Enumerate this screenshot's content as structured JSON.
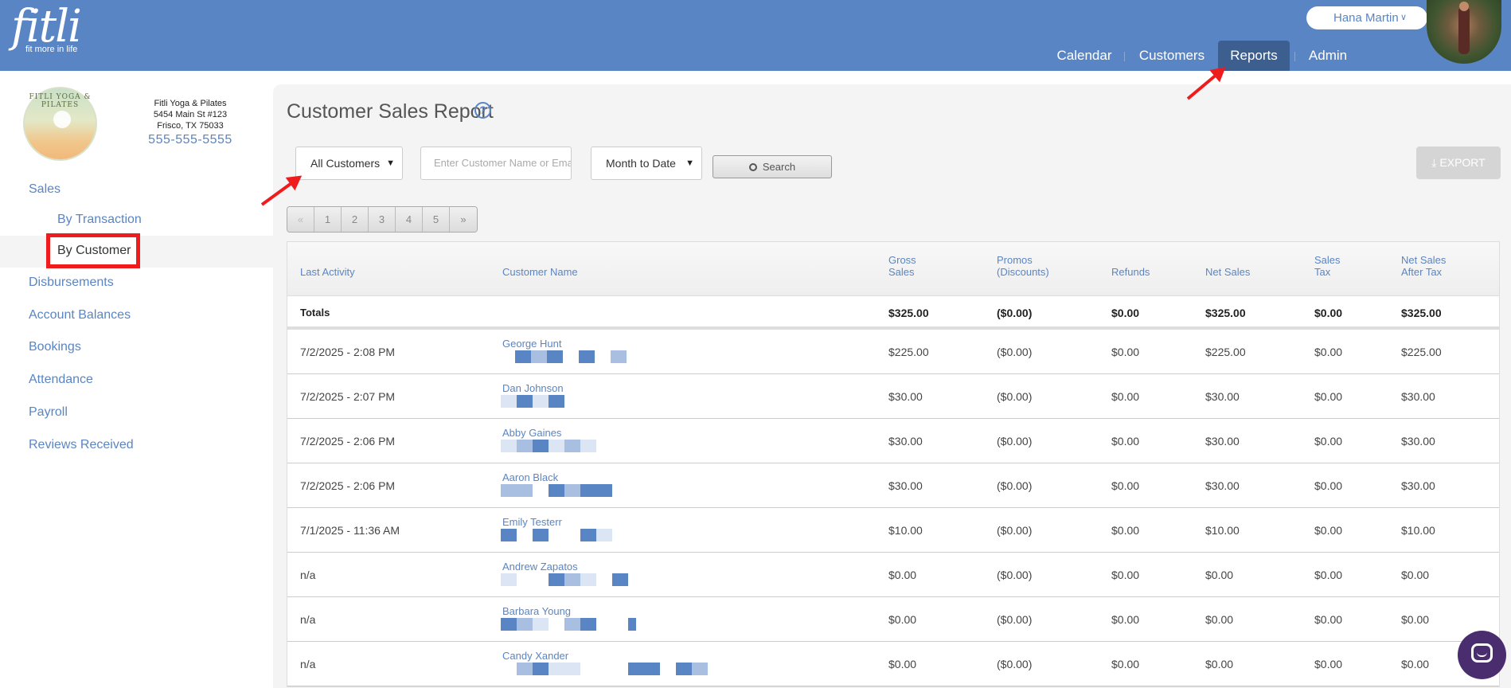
{
  "header": {
    "logo_text": "fitli",
    "logo_tagline": "fit more in life",
    "user_name": "Hana Martin",
    "nav": [
      {
        "label": "Calendar"
      },
      {
        "label": "Customers"
      },
      {
        "label": "Reports"
      },
      {
        "label": "Admin"
      }
    ]
  },
  "studio": {
    "logo_ring_text": "FITLI YOGA & PILATES",
    "name": "Fitli Yoga & Pilates",
    "address1": "5454 Main St #123",
    "address2": "Frisco, TX 75033",
    "phone": "555-555-5555"
  },
  "sidebar": {
    "sales": "Sales",
    "by_transaction": "By Transaction",
    "by_customer": "By Customer",
    "disbursements": "Disbursements",
    "account_balances": "Account Balances",
    "bookings": "Bookings",
    "attendance": "Attendance",
    "payroll": "Payroll",
    "reviews_received": "Reviews Received"
  },
  "report": {
    "title": "Customer Sales Report",
    "help_glyph": "?",
    "customer_filter": "All Customers",
    "search_placeholder": "Enter Customer Name or Email",
    "date_range": "Month to Date",
    "search_label": "Search",
    "export_label": "EXPORT",
    "pages": [
      "«",
      "1",
      "2",
      "3",
      "4",
      "5",
      "»"
    ]
  },
  "table": {
    "columns": {
      "last_activity": "Last Activity",
      "customer_name": "Customer Name",
      "gross_sales_1": "Gross",
      "gross_sales_2": "Sales",
      "promos_1": "Promos",
      "promos_2": "(Discounts)",
      "refunds": "Refunds",
      "net_sales": "Net Sales",
      "sales_tax_1": "Sales",
      "sales_tax_2": "Tax",
      "net_after_tax_1": "Net Sales",
      "net_after_tax_2": "After Tax"
    },
    "totals": {
      "label": "Totals",
      "gross": "$325.00",
      "promos": "($0.00)",
      "refunds": "$0.00",
      "net": "$325.00",
      "tax": "$0.00",
      "net_after_tax": "$325.00"
    },
    "rows": [
      {
        "last_activity": "7/2/2025 - 2:08 PM",
        "name": "George Hunt",
        "gross": "$225.00",
        "promos": "($0.00)",
        "refunds": "$0.00",
        "net": "$225.00",
        "tax": "$0.00",
        "net_after_tax": "$225.00"
      },
      {
        "last_activity": "7/2/2025 - 2:07 PM",
        "name": "Dan Johnson",
        "gross": "$30.00",
        "promos": "($0.00)",
        "refunds": "$0.00",
        "net": "$30.00",
        "tax": "$0.00",
        "net_after_tax": "$30.00"
      },
      {
        "last_activity": "7/2/2025 - 2:06 PM",
        "name": "Abby Gaines",
        "gross": "$30.00",
        "promos": "($0.00)",
        "refunds": "$0.00",
        "net": "$30.00",
        "tax": "$0.00",
        "net_after_tax": "$30.00"
      },
      {
        "last_activity": "7/2/2025 - 2:06 PM",
        "name": "Aaron Black",
        "gross": "$30.00",
        "promos": "($0.00)",
        "refunds": "$0.00",
        "net": "$30.00",
        "tax": "$0.00",
        "net_after_tax": "$30.00"
      },
      {
        "last_activity": "7/1/2025 - 11:36 AM",
        "name": "Emily Testerr",
        "gross": "$10.00",
        "promos": "($0.00)",
        "refunds": "$0.00",
        "net": "$10.00",
        "tax": "$0.00",
        "net_after_tax": "$10.00"
      },
      {
        "last_activity": "n/a",
        "name": "Andrew Zapatos",
        "gross": "$0.00",
        "promos": "($0.00)",
        "refunds": "$0.00",
        "net": "$0.00",
        "tax": "$0.00",
        "net_after_tax": "$0.00"
      },
      {
        "last_activity": "n/a",
        "name": "Barbara Young",
        "gross": "$0.00",
        "promos": "($0.00)",
        "refunds": "$0.00",
        "net": "$0.00",
        "tax": "$0.00",
        "net_after_tax": "$0.00"
      },
      {
        "last_activity": "n/a",
        "name": "Candy Xander",
        "gross": "$0.00",
        "promos": "($0.00)",
        "refunds": "$0.00",
        "net": "$0.00",
        "tax": "$0.00",
        "net_after_tax": "$0.00"
      }
    ]
  },
  "colors": {
    "brand_blue": "#5a85c4",
    "nav_active": "#3d5f90",
    "annotation_red": "#ee1c1c",
    "chat_purple": "#4a2d6e"
  },
  "icons": [
    "help-icon",
    "chevron-down-icon",
    "search-icon",
    "download-icon",
    "chat-icon"
  ]
}
